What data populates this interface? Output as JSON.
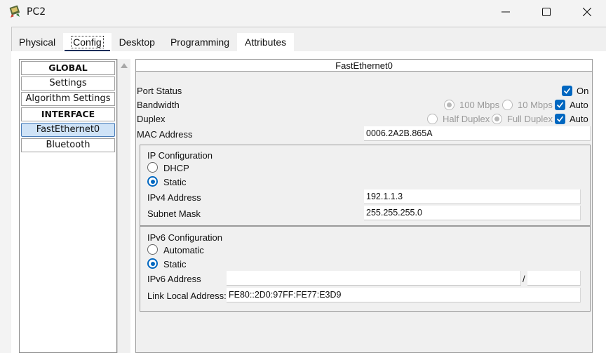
{
  "window": {
    "title": "PC2",
    "icon": "pc-app-icon",
    "controls": [
      "minimize-icon",
      "maximize-icon",
      "close-icon"
    ]
  },
  "tabs": [
    {
      "label": "Physical",
      "active": false
    },
    {
      "label": "Config",
      "active": true
    },
    {
      "label": "Desktop",
      "active": false
    },
    {
      "label": "Programming",
      "active": false
    },
    {
      "label": "Attributes",
      "active": false
    }
  ],
  "sidebar": {
    "items": [
      {
        "label": "GLOBAL",
        "type": "header"
      },
      {
        "label": "Settings",
        "type": "item"
      },
      {
        "label": "Algorithm Settings",
        "type": "item"
      },
      {
        "label": "INTERFACE",
        "type": "header"
      },
      {
        "label": "FastEthernet0",
        "type": "item",
        "selected": true
      },
      {
        "label": "Bluetooth",
        "type": "item"
      }
    ]
  },
  "panel": {
    "title": "FastEthernet0",
    "port_status": {
      "label": "Port Status",
      "on_label": "On",
      "on_checked": true
    },
    "bandwidth": {
      "label": "Bandwidth",
      "option_100": "100 Mbps",
      "option_10": "10 Mbps",
      "auto_label": "Auto",
      "auto_checked": true
    },
    "duplex": {
      "label": "Duplex",
      "option_half": "Half Duplex",
      "option_full": "Full Duplex",
      "auto_label": "Auto",
      "auto_checked": true
    },
    "mac": {
      "label": "MAC Address",
      "value": "0006.2A2B.865A"
    },
    "ipv4": {
      "title": "IP Configuration",
      "dhcp_label": "DHCP",
      "static_label": "Static",
      "selected": "Static",
      "address_label": "IPv4 Address",
      "address_value": "192.1.1.3",
      "mask_label": "Subnet Mask",
      "mask_value": "255.255.255.0"
    },
    "ipv6": {
      "title": "IPv6 Configuration",
      "automatic_label": "Automatic",
      "static_label": "Static",
      "selected": "Static",
      "address_label": "IPv6 Address",
      "address_value": "",
      "prefix_separator": "/",
      "prefix_value": "",
      "link_local_label": "Link Local Address:",
      "link_local_value": "FE80::2D0:97FF:FE77:E3D9"
    }
  },
  "colors": {
    "accent": "#0067c0",
    "tab_underline": "#1a2e5a",
    "selected_item": "#cfe3f7"
  }
}
